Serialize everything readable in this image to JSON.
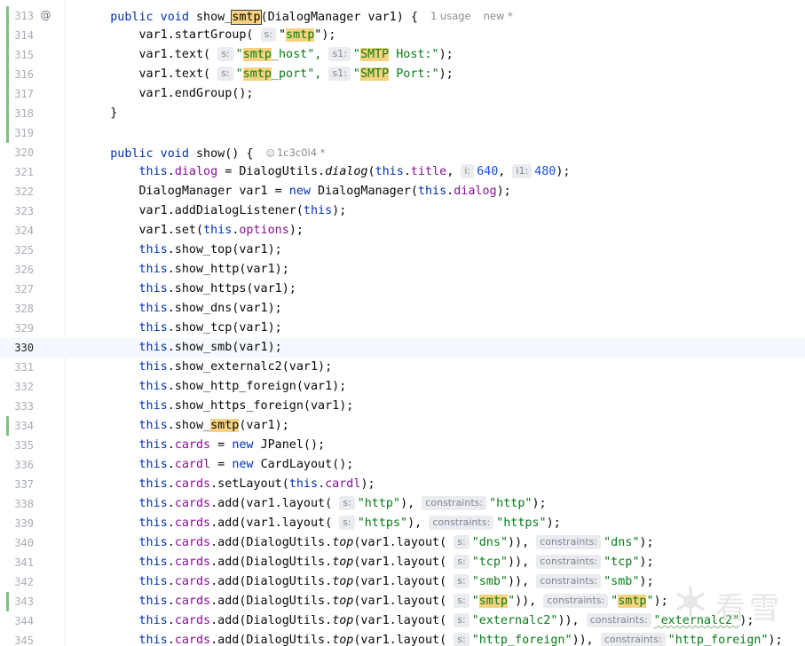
{
  "editor": {
    "current_line": 330,
    "lines": [
      {
        "num": "313",
        "changed": true,
        "icon": "override-icon",
        "icon_glyph": "@",
        "segments": [
          [
            "    ",
            ""
          ],
          [
            "public void ",
            "k"
          ],
          [
            "show_",
            ""
          ],
          [
            "smtp",
            "hlb"
          ],
          [
            "(DialogManager var1) {",
            ""
          ]
        ],
        "meta": [
          "1 usage",
          "new *"
        ]
      },
      {
        "num": "314",
        "changed": true,
        "segments": [
          [
            "        var1.startGroup( ",
            ""
          ],
          [
            "s:",
            "ih"
          ],
          [
            "\"",
            ""
          ],
          [
            "smtp",
            "s hl"
          ],
          [
            "\");",
            ""
          ]
        ]
      },
      {
        "num": "315",
        "changed": true,
        "segments": [
          [
            "        var1.text( ",
            ""
          ],
          [
            "s:",
            "ih"
          ],
          [
            "\"",
            "s"
          ],
          [
            "smtp",
            "s hl"
          ],
          [
            "_host\", ",
            "s"
          ],
          [
            "s1:",
            "ih"
          ],
          [
            "\"",
            "s"
          ],
          [
            "SMTP",
            "s hl"
          ],
          [
            " Host:\"",
            "s"
          ],
          [
            ");",
            ""
          ]
        ]
      },
      {
        "num": "316",
        "changed": true,
        "segments": [
          [
            "        var1.text( ",
            ""
          ],
          [
            "s:",
            "ih"
          ],
          [
            "\"",
            "s"
          ],
          [
            "smtp",
            "s hl"
          ],
          [
            "_port\", ",
            "s"
          ],
          [
            "s1:",
            "ih"
          ],
          [
            "\"",
            "s"
          ],
          [
            "SMTP",
            "s hl"
          ],
          [
            " Port:\"",
            "s"
          ],
          [
            ");",
            ""
          ]
        ]
      },
      {
        "num": "317",
        "changed": true,
        "segments": [
          [
            "        var1.endGroup();",
            ""
          ]
        ]
      },
      {
        "num": "318",
        "changed": true,
        "segments": [
          [
            "    }",
            ""
          ]
        ]
      },
      {
        "num": "319",
        "changed": true,
        "segments": []
      },
      {
        "num": "320",
        "changed": false,
        "segments": [
          [
            "    ",
            ""
          ],
          [
            "public void ",
            "k"
          ],
          [
            "show() {",
            ""
          ]
        ],
        "meta_author": "1c3c0l4 *"
      },
      {
        "num": "321",
        "changed": false,
        "segments": [
          [
            "        ",
            ""
          ],
          [
            "this",
            "k"
          ],
          [
            ".",
            ""
          ],
          [
            "dialog",
            "f"
          ],
          [
            " = DialogUtils.",
            ""
          ],
          [
            "dialog",
            "i"
          ],
          [
            "(",
            ""
          ],
          [
            "this",
            "k"
          ],
          [
            ".",
            ""
          ],
          [
            "title",
            "f"
          ],
          [
            ", ",
            ""
          ],
          [
            "i:",
            "ih"
          ],
          [
            "640",
            "n"
          ],
          [
            ", ",
            ""
          ],
          [
            "i1:",
            "ih"
          ],
          [
            "480",
            "n"
          ],
          [
            ");",
            ""
          ]
        ]
      },
      {
        "num": "322",
        "changed": false,
        "segments": [
          [
            "        DialogManager var1 = ",
            ""
          ],
          [
            "new ",
            "k"
          ],
          [
            "DialogManager(",
            ""
          ],
          [
            "this",
            "k"
          ],
          [
            ".",
            ""
          ],
          [
            "dialog",
            "f"
          ],
          [
            ");",
            ""
          ]
        ]
      },
      {
        "num": "323",
        "changed": false,
        "segments": [
          [
            "        var1.addDialogListener(",
            ""
          ],
          [
            "this",
            "k"
          ],
          [
            ");",
            ""
          ]
        ]
      },
      {
        "num": "324",
        "changed": false,
        "segments": [
          [
            "        var1.set(",
            ""
          ],
          [
            "this",
            "k"
          ],
          [
            ".",
            ""
          ],
          [
            "options",
            "f"
          ],
          [
            ");",
            ""
          ]
        ]
      },
      {
        "num": "325",
        "changed": false,
        "segments": [
          [
            "        ",
            ""
          ],
          [
            "this",
            "k"
          ],
          [
            ".show_top(var1);",
            ""
          ]
        ]
      },
      {
        "num": "326",
        "changed": false,
        "segments": [
          [
            "        ",
            ""
          ],
          [
            "this",
            "k"
          ],
          [
            ".show_http(var1);",
            ""
          ]
        ]
      },
      {
        "num": "327",
        "changed": false,
        "segments": [
          [
            "        ",
            ""
          ],
          [
            "this",
            "k"
          ],
          [
            ".show_https(var1);",
            ""
          ]
        ]
      },
      {
        "num": "328",
        "changed": false,
        "segments": [
          [
            "        ",
            ""
          ],
          [
            "this",
            "k"
          ],
          [
            ".show_dns(var1);",
            ""
          ]
        ]
      },
      {
        "num": "329",
        "changed": false,
        "segments": [
          [
            "        ",
            ""
          ],
          [
            "this",
            "k"
          ],
          [
            ".show_tcp(var1);",
            ""
          ]
        ]
      },
      {
        "num": "330",
        "changed": false,
        "segments": [
          [
            "        ",
            ""
          ],
          [
            "this",
            "k"
          ],
          [
            ".show_smb(var1);",
            ""
          ]
        ]
      },
      {
        "num": "331",
        "changed": false,
        "segments": [
          [
            "        ",
            ""
          ],
          [
            "this",
            "k"
          ],
          [
            ".show_externalc2(var1);",
            ""
          ]
        ]
      },
      {
        "num": "332",
        "changed": false,
        "segments": [
          [
            "        ",
            ""
          ],
          [
            "this",
            "k"
          ],
          [
            ".show_http_foreign(var1);",
            ""
          ]
        ]
      },
      {
        "num": "333",
        "changed": false,
        "segments": [
          [
            "        ",
            ""
          ],
          [
            "this",
            "k"
          ],
          [
            ".show_https_foreign(var1);",
            ""
          ]
        ]
      },
      {
        "num": "334",
        "changed": true,
        "segments": [
          [
            "        ",
            ""
          ],
          [
            "this",
            "k"
          ],
          [
            ".show_",
            ""
          ],
          [
            "smtp",
            "hl"
          ],
          [
            "(var1);",
            ""
          ]
        ]
      },
      {
        "num": "335",
        "changed": false,
        "segments": [
          [
            "        ",
            ""
          ],
          [
            "this",
            "k"
          ],
          [
            ".",
            ""
          ],
          [
            "cards",
            "f"
          ],
          [
            " = ",
            ""
          ],
          [
            "new ",
            "k"
          ],
          [
            "JPanel();",
            ""
          ]
        ]
      },
      {
        "num": "336",
        "changed": false,
        "segments": [
          [
            "        ",
            ""
          ],
          [
            "this",
            "k"
          ],
          [
            ".",
            ""
          ],
          [
            "cardl",
            "f"
          ],
          [
            " = ",
            ""
          ],
          [
            "new ",
            "k"
          ],
          [
            "CardLayout();",
            ""
          ]
        ]
      },
      {
        "num": "337",
        "changed": false,
        "segments": [
          [
            "        ",
            ""
          ],
          [
            "this",
            "k"
          ],
          [
            ".",
            ""
          ],
          [
            "cards",
            "f"
          ],
          [
            ".setLayout(",
            ""
          ],
          [
            "this",
            "k"
          ],
          [
            ".",
            ""
          ],
          [
            "cardl",
            "f"
          ],
          [
            ");",
            ""
          ]
        ]
      },
      {
        "num": "338",
        "changed": false,
        "segments": [
          [
            "        ",
            ""
          ],
          [
            "this",
            "k"
          ],
          [
            ".",
            ""
          ],
          [
            "cards",
            "f"
          ],
          [
            ".add(var1.layout( ",
            ""
          ],
          [
            "s:",
            "ih"
          ],
          [
            "\"http\"",
            "s"
          ],
          [
            "), ",
            ""
          ],
          [
            "constraints:",
            "ih"
          ],
          [
            "\"http\"",
            "s"
          ],
          [
            ");",
            ""
          ]
        ]
      },
      {
        "num": "339",
        "changed": false,
        "segments": [
          [
            "        ",
            ""
          ],
          [
            "this",
            "k"
          ],
          [
            ".",
            ""
          ],
          [
            "cards",
            "f"
          ],
          [
            ".add(var1.layout( ",
            ""
          ],
          [
            "s:",
            "ih"
          ],
          [
            "\"https\"",
            "s"
          ],
          [
            "), ",
            ""
          ],
          [
            "constraints:",
            "ih"
          ],
          [
            "\"https\"",
            "s"
          ],
          [
            ");",
            ""
          ]
        ]
      },
      {
        "num": "340",
        "changed": false,
        "segments": [
          [
            "        ",
            ""
          ],
          [
            "this",
            "k"
          ],
          [
            ".",
            ""
          ],
          [
            "cards",
            "f"
          ],
          [
            ".add(DialogUtils.",
            ""
          ],
          [
            "top",
            "i"
          ],
          [
            "(var1.layout( ",
            ""
          ],
          [
            "s:",
            "ih"
          ],
          [
            "\"dns\"",
            "s"
          ],
          [
            ")), ",
            ""
          ],
          [
            "constraints:",
            "ih"
          ],
          [
            "\"dns\"",
            "s"
          ],
          [
            ");",
            ""
          ]
        ]
      },
      {
        "num": "341",
        "changed": false,
        "segments": [
          [
            "        ",
            ""
          ],
          [
            "this",
            "k"
          ],
          [
            ".",
            ""
          ],
          [
            "cards",
            "f"
          ],
          [
            ".add(DialogUtils.",
            ""
          ],
          [
            "top",
            "i"
          ],
          [
            "(var1.layout( ",
            ""
          ],
          [
            "s:",
            "ih"
          ],
          [
            "\"tcp\"",
            "s"
          ],
          [
            ")), ",
            ""
          ],
          [
            "constraints:",
            "ih"
          ],
          [
            "\"tcp\"",
            "s"
          ],
          [
            ");",
            ""
          ]
        ]
      },
      {
        "num": "342",
        "changed": false,
        "segments": [
          [
            "        ",
            ""
          ],
          [
            "this",
            "k"
          ],
          [
            ".",
            ""
          ],
          [
            "cards",
            "f"
          ],
          [
            ".add(DialogUtils.",
            ""
          ],
          [
            "top",
            "i"
          ],
          [
            "(var1.layout( ",
            ""
          ],
          [
            "s:",
            "ih"
          ],
          [
            "\"smb\"",
            "s"
          ],
          [
            ")), ",
            ""
          ],
          [
            "constraints:",
            "ih"
          ],
          [
            "\"smb\"",
            "s"
          ],
          [
            ");",
            ""
          ]
        ]
      },
      {
        "num": "343",
        "changed": true,
        "segments": [
          [
            "        ",
            ""
          ],
          [
            "this",
            "k"
          ],
          [
            ".",
            ""
          ],
          [
            "cards",
            "f"
          ],
          [
            ".add(DialogUtils.",
            ""
          ],
          [
            "top",
            "i"
          ],
          [
            "(var1.layout( ",
            ""
          ],
          [
            "s:",
            "ih"
          ],
          [
            "\"",
            "s"
          ],
          [
            "smtp",
            "s hl"
          ],
          [
            "\"",
            "s"
          ],
          [
            ")), ",
            ""
          ],
          [
            "constraints:",
            "ih"
          ],
          [
            "\"",
            "s"
          ],
          [
            "smtp",
            "s hl"
          ],
          [
            "\"",
            "s"
          ],
          [
            ");",
            ""
          ]
        ]
      },
      {
        "num": "344",
        "changed": false,
        "segments": [
          [
            "        ",
            ""
          ],
          [
            "this",
            "k"
          ],
          [
            ".",
            ""
          ],
          [
            "cards",
            "f"
          ],
          [
            ".add(DialogUtils.",
            ""
          ],
          [
            "top",
            "i"
          ],
          [
            "(var1.layout( ",
            ""
          ],
          [
            "s:",
            "ih"
          ],
          [
            "\"externalc2\"",
            "s"
          ],
          [
            ")), ",
            ""
          ],
          [
            "constraints:",
            "ih"
          ],
          [
            "\"externalc2\"",
            "s wavy"
          ],
          [
            ");",
            ""
          ]
        ]
      },
      {
        "num": "345",
        "changed": false,
        "segments": [
          [
            "        ",
            ""
          ],
          [
            "this",
            "k"
          ],
          [
            ".",
            ""
          ],
          [
            "cards",
            "f"
          ],
          [
            ".add(DialogUtils.",
            ""
          ],
          [
            "top",
            "i"
          ],
          [
            "(var1.layout( ",
            ""
          ],
          [
            "s:",
            "ih"
          ],
          [
            "\"http_foreign\"",
            "s"
          ],
          [
            ")), ",
            ""
          ],
          [
            "constraints:",
            "ih"
          ],
          [
            "\"http_foreign\"",
            "s"
          ],
          [
            ");",
            ""
          ]
        ]
      }
    ]
  },
  "watermark": {
    "text": "看雪",
    "icon": "snowflake-logo-icon"
  },
  "colors": {
    "keyword": "#0033b3",
    "field": "#871094",
    "string": "#067d17",
    "number": "#1750eb",
    "highlight": "#f8d27e",
    "change_bar": "#7fbf7f"
  }
}
